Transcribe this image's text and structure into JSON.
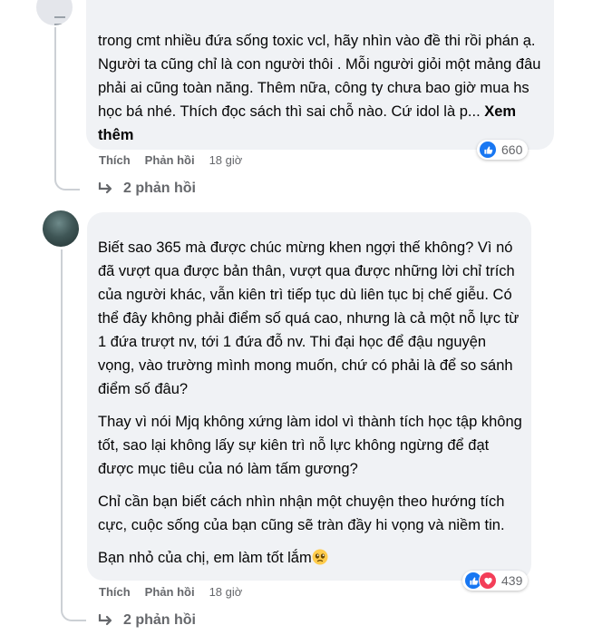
{
  "comments": [
    {
      "paragraphs": [
        "trong cmt nhiều đứa sống toxic vcl, hãy nhìn vào đề thi rồi phán ạ. Người ta cũng chỉ là con người thôi . Mỗi người giỏi một mảng đâu phải ai cũng toàn năng. Thêm nữa, công ty chưa bao giờ mua hs học bá nhé. Thích đọc sách thì sai chỗ nào. Cứ idol là p... "
      ],
      "see_more": "Xem thêm",
      "reaction_count": "660",
      "reaction_icons": [
        "like-icon"
      ],
      "like_label": "Thích",
      "reply_label": "Phản hồi",
      "time": "18 giờ",
      "replies_label": "2 phản hồi"
    },
    {
      "paragraphs": [
        "Biết sao 365 mà được chúc mừng khen ngợi thế không? Vì nó đã vượt qua được bản thân, vượt qua được những lời chỉ trích của người khác, vẫn kiên trì tiếp tục dù liên tục bị chế giễu. Có thể đây không phải điểm số quá cao, nhưng là cả một nỗ lực từ 1 đứa trượt nv, tới 1 đứa đỗ nv. Thi đại học để đậu nguyện vọng, vào trường mình mong muốn, chứ có phải là để so sánh điểm số đâu?",
        "Thay vì nói Mjq không xứng làm idol vì thành tích học tập không tốt, sao lại không lấy sự kiên trì nỗ lực không ngừng để đạt được mục tiêu của nó làm tấm gương?",
        "Chỉ cần bạn biết cách nhìn nhận một chuyện theo hướng tích cực, cuộc sống của bạn cũng sẽ tràn đầy hi vọng và niềm tin.",
        "Bạn nhỏ của chị, em làm tốt lắm"
      ],
      "end_emoji": "pleading-face-icon",
      "reaction_count": "439",
      "reaction_icons": [
        "like-icon",
        "love-icon"
      ],
      "like_label": "Thích",
      "reply_label": "Phản hồi",
      "time": "18 giờ",
      "replies_label": "2 phản hồi"
    }
  ],
  "colors": {
    "bubble": "#f0f2f5",
    "meta_text": "#65676b",
    "like_blue": "#1877f2",
    "love_red": "#f33e58"
  }
}
